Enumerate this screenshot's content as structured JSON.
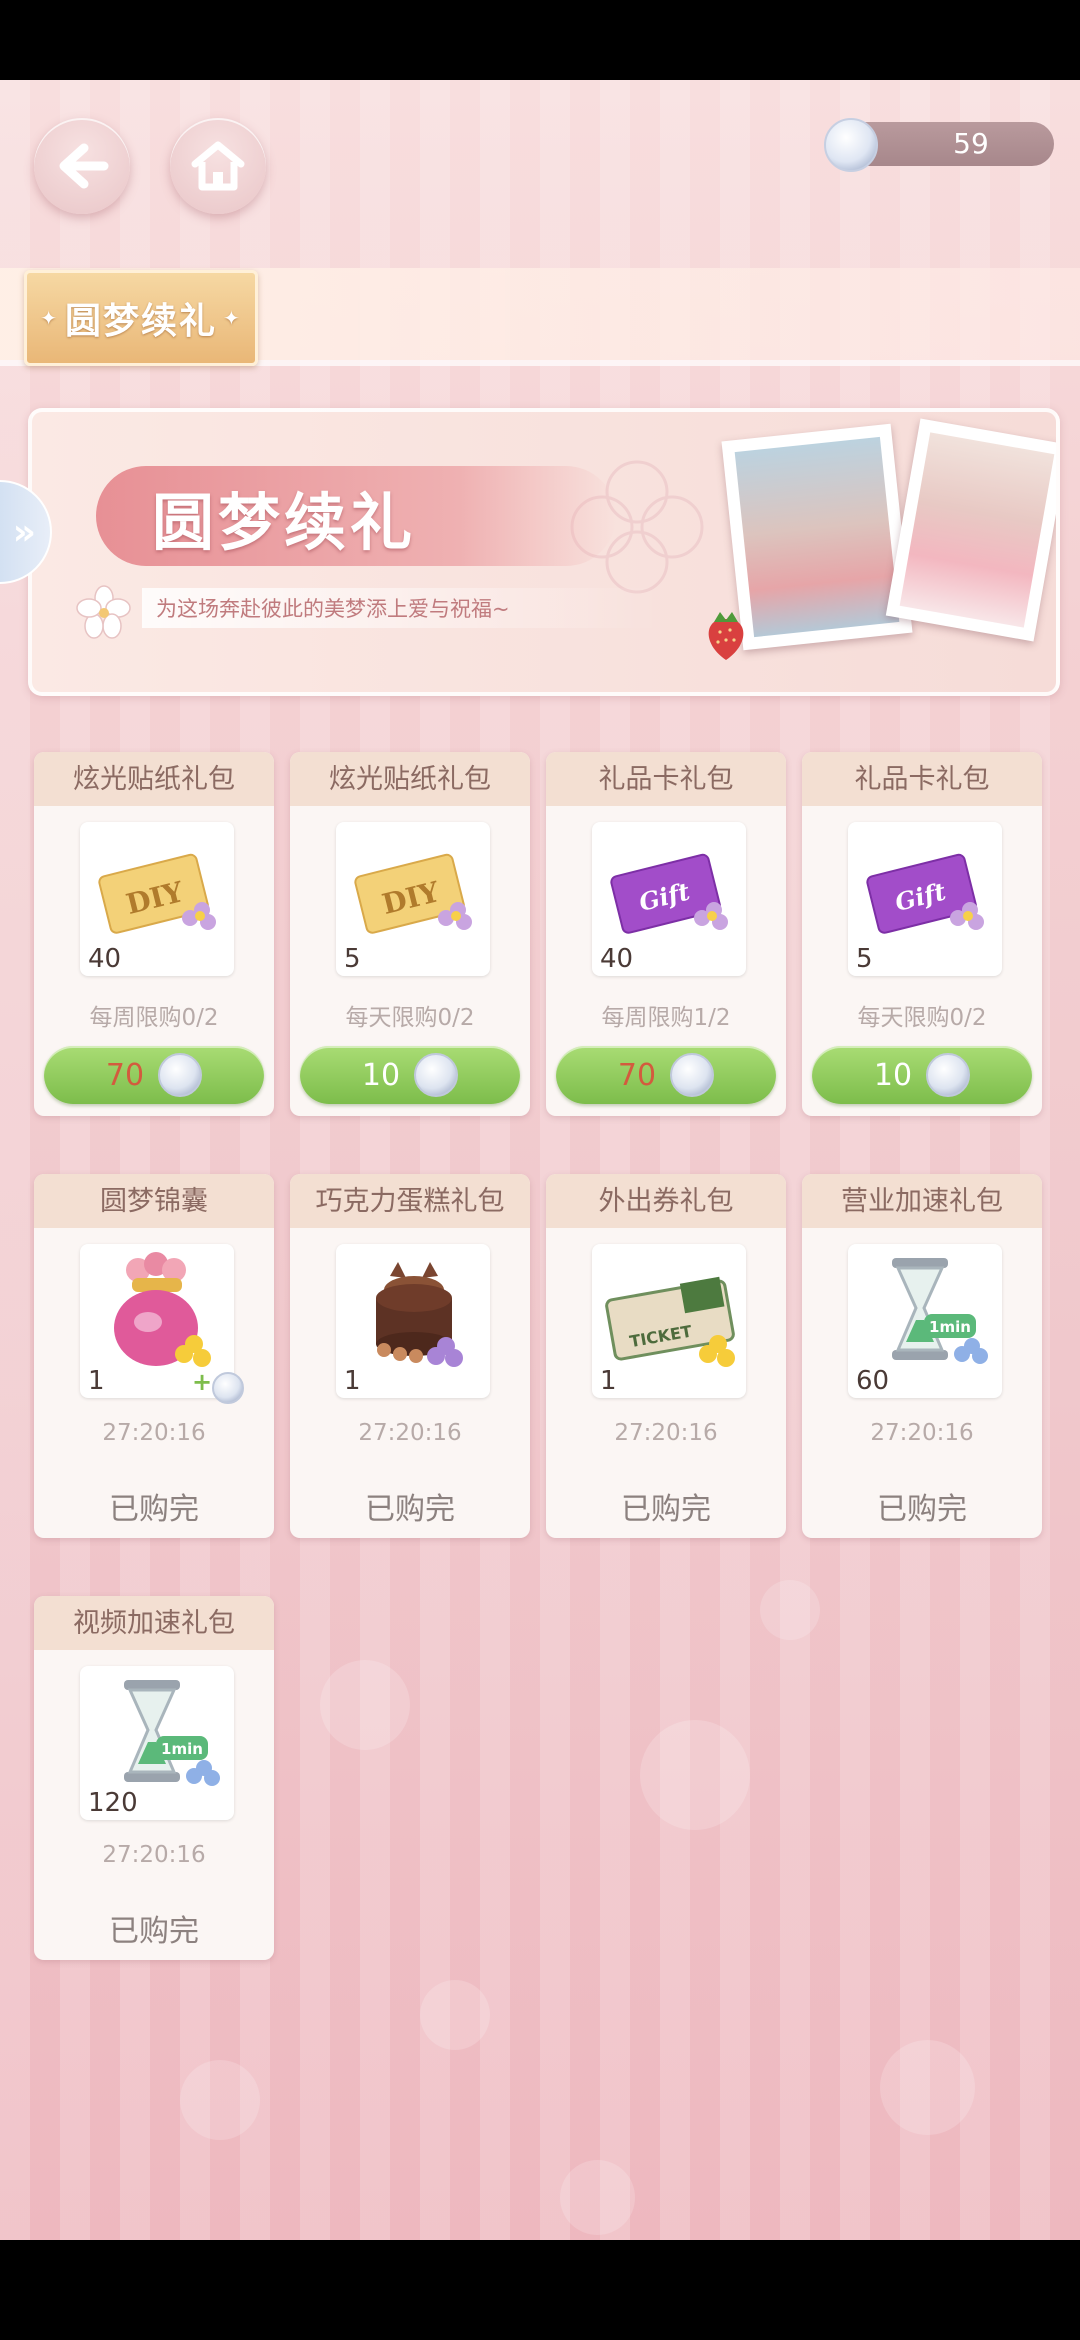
{
  "header": {
    "back_icon": "back-arrow-icon",
    "home_icon": "home-icon",
    "currency_amount": "59"
  },
  "tabs": [
    {
      "label": "圆梦续礼",
      "active": true
    }
  ],
  "banner": {
    "title": "圆梦续礼",
    "subtitle": "为这场奔赴彼此的美梦添上爱与祝福~"
  },
  "packs_row1": [
    {
      "title": "炫光贴纸礼包",
      "icon": "diy-sticker",
      "qty": "40",
      "limit": "每周限购0/2",
      "price": "70",
      "price_color": "#d35b3e"
    },
    {
      "title": "炫光贴纸礼包",
      "icon": "diy-sticker",
      "qty": "5",
      "limit": "每天限购0/2",
      "price": "10",
      "price_color": "#ffffff"
    },
    {
      "title": "礼品卡礼包",
      "icon": "gift-card",
      "qty": "40",
      "limit": "每周限购1/2",
      "price": "70",
      "price_color": "#d35b3e"
    },
    {
      "title": "礼品卡礼包",
      "icon": "gift-card",
      "qty": "5",
      "limit": "每天限购0/2",
      "price": "10",
      "price_color": "#ffffff"
    }
  ],
  "packs_row2": [
    {
      "title": "圆梦锦囊",
      "icon": "lucky-bag",
      "qty": "1",
      "timer": "27:20:16",
      "status": "已购完"
    },
    {
      "title": "巧克力蛋糕礼包",
      "icon": "chocolate-cake",
      "qty": "1",
      "timer": "27:20:16",
      "status": "已购完"
    },
    {
      "title": "外出券礼包",
      "icon": "train-ticket",
      "qty": "1",
      "timer": "27:20:16",
      "status": "已购完"
    },
    {
      "title": "营业加速礼包",
      "icon": "hourglass",
      "qty": "60",
      "timer": "27:20:16",
      "status": "已购完"
    }
  ],
  "packs_row3": [
    {
      "title": "视频加速礼包",
      "icon": "hourglass",
      "qty": "120",
      "timer": "27:20:16",
      "status": "已购完"
    }
  ],
  "labels": {
    "ticket_text": "TICKET",
    "gift_text": "Gift",
    "diy_text": "DIY",
    "hourglass_text": "1min"
  }
}
